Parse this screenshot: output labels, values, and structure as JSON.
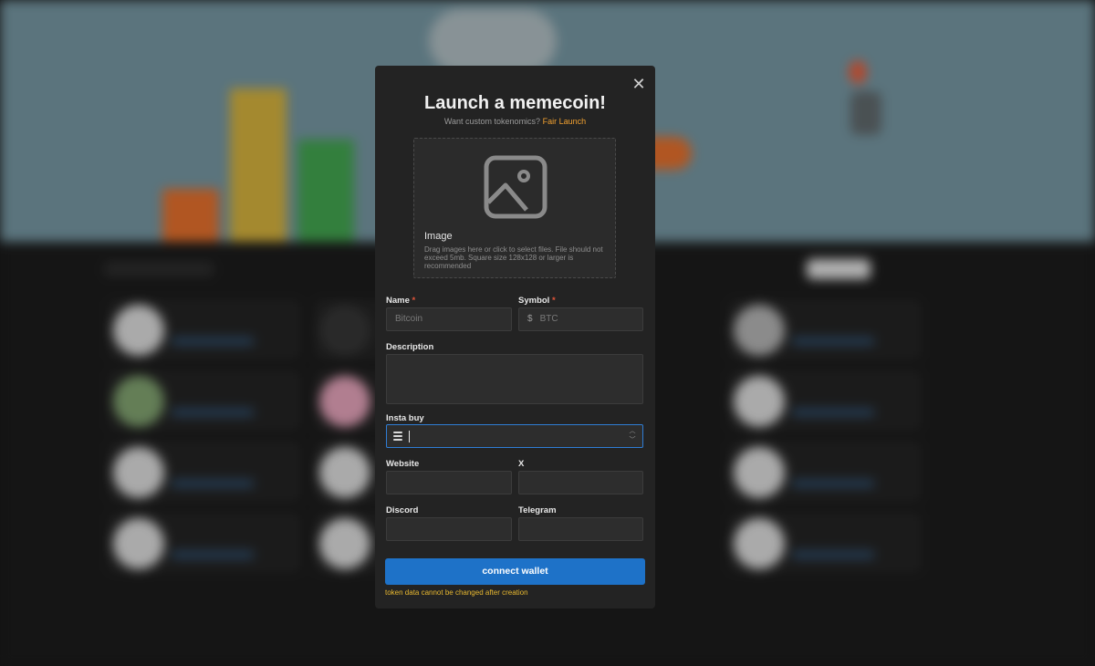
{
  "modal": {
    "title": "Launch a memecoin!",
    "subtitle_prefix": "Want custom tokenomics?",
    "fair_launch_link": "Fair Launch",
    "close_icon": "close-icon"
  },
  "image_upload": {
    "title": "Image",
    "help_text": "Drag images here or click to select files. File should not exceed 5mb. Square size 128x128 or larger is recommended",
    "icon": "image-icon"
  },
  "fields": {
    "name": {
      "label": "Name",
      "required_mark": "*",
      "placeholder": "Bitcoin"
    },
    "symbol": {
      "label": "Symbol",
      "required_mark": "*",
      "prefix": "$",
      "placeholder": "BTC"
    },
    "description": {
      "label": "Description"
    },
    "insta_buy": {
      "label": "Insta buy",
      "value": "",
      "icon": "solana-icon"
    },
    "website": {
      "label": "Website"
    },
    "x": {
      "label": "X"
    },
    "discord": {
      "label": "Discord"
    },
    "telegram": {
      "label": "Telegram"
    }
  },
  "actions": {
    "connect_wallet": "connect wallet"
  },
  "warning": "token data cannot be changed after creation",
  "colors": {
    "accent_orange": "#f0a030",
    "primary_blue": "#1e72c8",
    "required_red": "#e2553a",
    "warning_yellow": "#e8b830",
    "modal_bg": "#232323"
  }
}
